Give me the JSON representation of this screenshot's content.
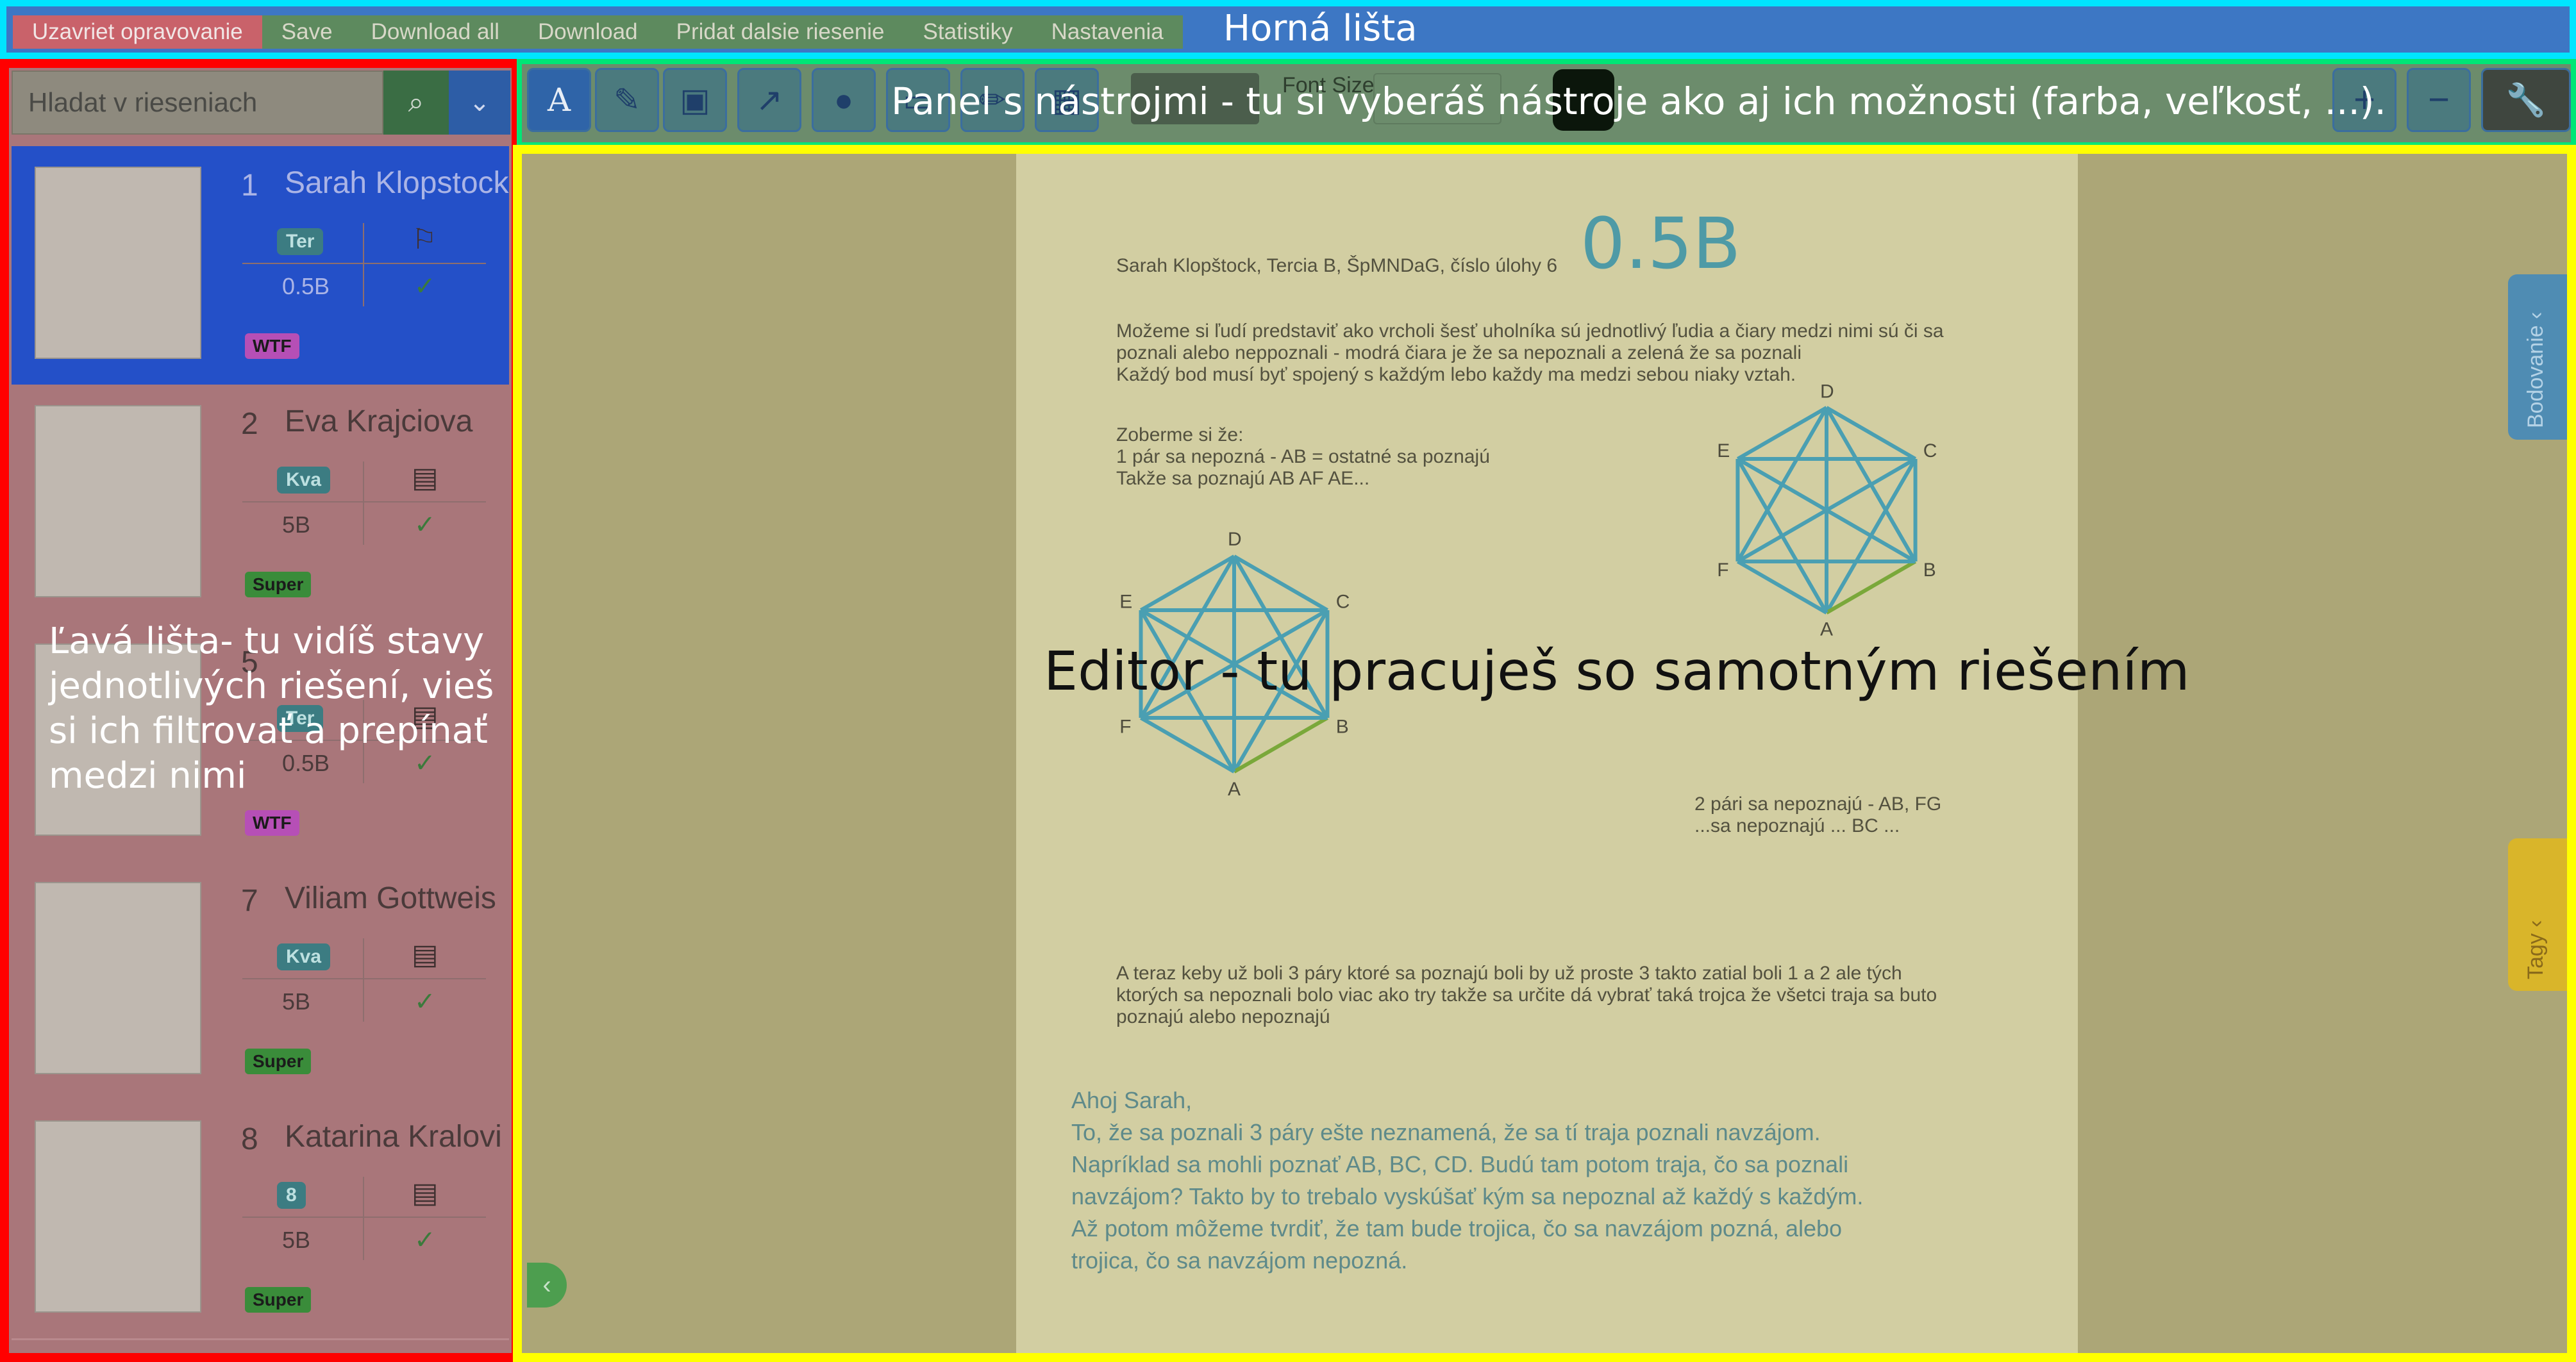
{
  "menu": [
    "Uzavriet opravovanie",
    "Save",
    "Download all",
    "Download",
    "Pridat dalsie riesenie",
    "Statistiky",
    "Nastavenia"
  ],
  "search": {
    "placeholder": "Hladat v rieseniach"
  },
  "toolbar": {
    "font_size_label": "Font Size"
  },
  "submissions": [
    {
      "num": "1",
      "name": "Sarah Klopstock",
      "badge": "Ter",
      "score": "0.5B",
      "tag": "WTF"
    },
    {
      "num": "2",
      "name": "Eva Krajciova",
      "badge": "Kva",
      "score": "5B",
      "tag": "Super"
    },
    {
      "num": "5",
      "name": "",
      "badge": "Ter",
      "score": "0.5B",
      "tag": "WTF"
    },
    {
      "num": "7",
      "name": "Viliam Gottweis",
      "badge": "Kva",
      "score": "5B",
      "tag": "Super"
    },
    {
      "num": "8",
      "name": "Katarina Kralovi",
      "badge": "8",
      "score": "5B",
      "tag": "Super"
    }
  ],
  "document": {
    "header": "Sarah Klopštock, Tercia B, ŠpMNDaG, číslo úlohy 6",
    "handwritten_score": "0.5B",
    "p1": [
      "Možeme si ľudí predstaviť ako vrcholi šesť uholníka sú jednotlivý ľudia a čiary medzi nimi sú či sa",
      "poznali alebo neppoznali - modrá čiara je že sa nepoznali a zelená že sa poznali",
      "Každý bod musí byť spojený s každým lebo každy ma medzi sebou niaky vztah."
    ],
    "p2": [
      "Zoberme si že:",
      "1 pár sa nepozná - AB = ostatné sa poznajú",
      "Takže sa poznajú AB AF AE..."
    ],
    "p3": [
      "2 pári sa nepoznajú - AB, FG",
      "...sa nepoznajú ... BC ..."
    ],
    "p4": [
      "A teraz keby už boli 3 páry ktoré sa poznajú boli by už proste 3 takto zatial boli 1 a 2 ale tých",
      "ktorých sa nepoznali bolo viac ako try takže sa určite dá vybrať taká trojca že všetci traja sa buto",
      "poznajú alebo nepoznajú"
    ],
    "comment": [
      "Ahoj Sarah,",
      "To, že sa poznali 3 páry ešte neznamená, že sa tí traja poznali navzájom.",
      "Napríklad sa mohli poznať AB, BC, CD. Budú tam potom traja, čo sa poznali",
      "navzájom? Takto by to trebalo vyskúšať kým sa nepoznal až každý s každým.",
      "Až potom môžeme tvrdiť, že tam bude trojica, čo sa navzájom pozná, alebo",
      "trojica, čo sa navzájom nepozná."
    ],
    "vertices": {
      "A": "A",
      "B": "B",
      "C": "C",
      "D": "D",
      "E": "E",
      "F": "F"
    }
  },
  "tabs": {
    "grading": "Bodovanie",
    "tags": "Tagy"
  },
  "annotations": {
    "top": "Horná lišta",
    "toolbar": "Panel s nástrojmi - tu si  vyberáš nástroje ako aj ich možnosti (farba, veľkosť, ...).",
    "left": [
      "Ľavá lišta- tu vidíš stavy",
      "jednotlivých riešení, vieš",
      "si ich filtrovať a prepínať",
      "medzi nimi"
    ],
    "editor": "Editor - tu pracuješ so samotným riešením"
  },
  "colors": {
    "top_frame": "#00e5ff",
    "left_frame": "#ff0000",
    "toolbar_frame": "#00e676",
    "editor_frame": "#ffff00"
  }
}
